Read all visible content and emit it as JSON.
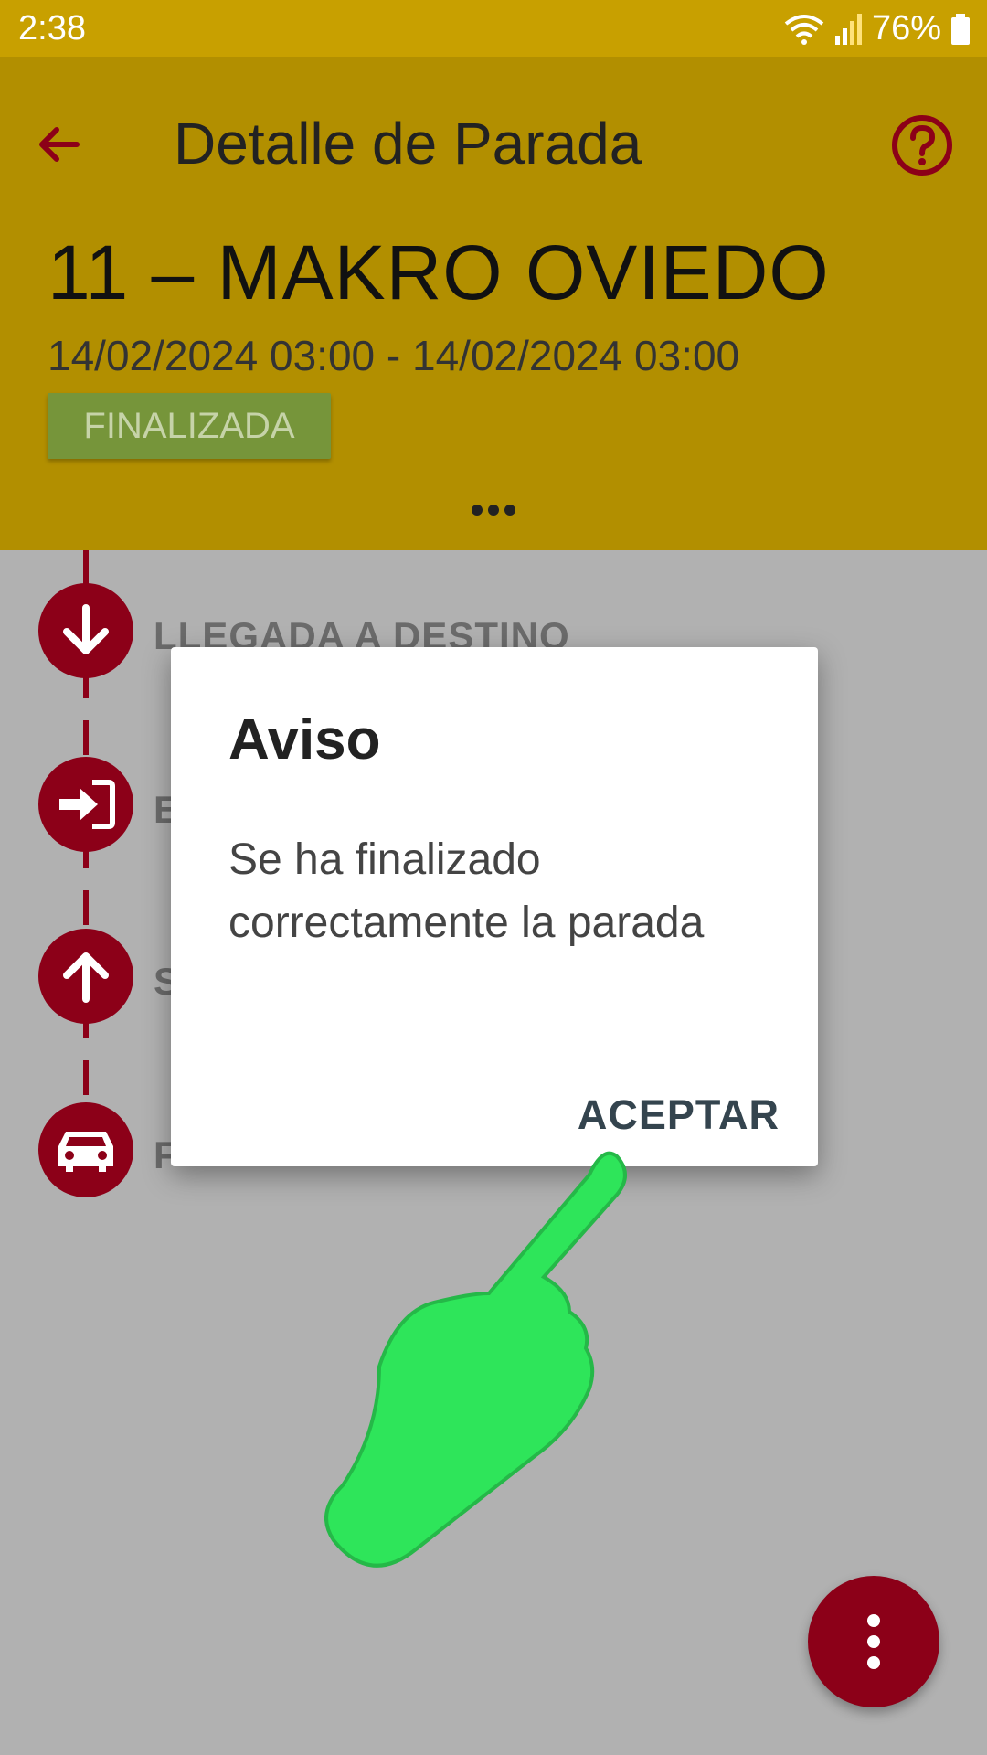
{
  "status_bar": {
    "time": "2:38",
    "battery": "76%"
  },
  "header": {
    "title": "Detalle de Parada",
    "stop_name": "11 – MAKRO OVIEDO",
    "dates": "14/02/2024 03:00 - 14/02/2024 03:00",
    "status": "FINALIZADA"
  },
  "timeline": {
    "steps": [
      {
        "label": "LLEGADA A DESTINO",
        "icon": "arrow-down-icon"
      },
      {
        "label": "E",
        "icon": "enter-icon"
      },
      {
        "label": "S",
        "icon": "arrow-up-icon"
      },
      {
        "label": "F",
        "icon": "car-icon"
      }
    ]
  },
  "dialog": {
    "title": "Aviso",
    "message": "Se ha finalizado correctamente la parada",
    "accept_label": "ACEPTAR"
  },
  "colors": {
    "header": "#b28f00",
    "accent": "#8c0018",
    "badge": "#76953a",
    "pointer": "#2ee55a"
  }
}
